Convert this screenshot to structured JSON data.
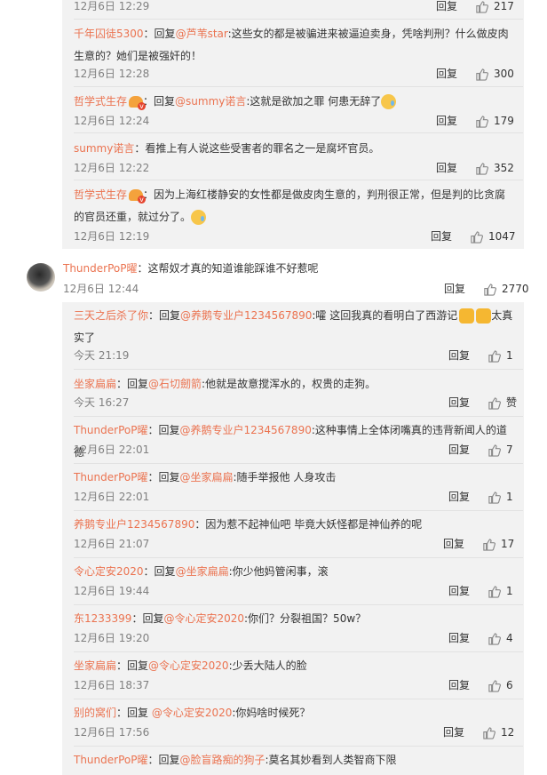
{
  "top_bar": {
    "time": "12月6日 12:29",
    "reply": "回复",
    "likes": "217"
  },
  "group1": [
    {
      "name": "千年囚徒5300",
      "prefix": "：回复",
      "at": "@芦苇star",
      "text": ":这些女的都是被骗进来被逼迫卖身，凭啥判刑？什么做皮肉生意的？她们是被强奸的！",
      "time": "12月6日 12:28",
      "reply": "回复",
      "likes": "300"
    },
    {
      "name": "哲学式生存",
      "prefix": "：回复",
      "at": "@summy诺言",
      "text": ":这就是欲加之罪 何患无辞了",
      "time": "12月6日 12:24",
      "reply": "回复",
      "likes": "179"
    },
    {
      "name": "summy诺言",
      "prefix": "：",
      "at": "",
      "text": "看推上有人说这些受害者的罪名之一是腐坏官员。",
      "time": "12月6日 12:22",
      "reply": "回复",
      "likes": "352"
    },
    {
      "name": "哲学式生存",
      "prefix": "：",
      "at": "",
      "text": "因为上海红楼静安的女性都是做皮肉生意的，判刑很正常，但是判的比贪腐的官员还重，就过分了。",
      "time": "12月6日 12:19",
      "reply": "回复",
      "likes": "1047"
    }
  ],
  "main_comment": {
    "name": "ThunderPoP曜",
    "text": "：这帮奴才真的知道谁能踩谁不好惹呢",
    "time": "12月6日 12:44",
    "reply": "回复",
    "likes": "2770"
  },
  "group2": [
    {
      "name": "三天之后杀了你",
      "prefix": "：回复",
      "at": "@养鹅专业户1234567890",
      "text": ":嚯 这回我真的看明白了西游记",
      "tail": "太真实了",
      "time": "今天 21:19",
      "reply": "回复",
      "likes": "1"
    },
    {
      "name": "坐家扁扁",
      "prefix": "：回复",
      "at": "@石切劒箭",
      "text": ":他就是故意搅浑水的，权贵的走狗。",
      "time": "今天 16:27",
      "reply": "回复",
      "likes": "赞"
    },
    {
      "name": "ThunderPoP曜",
      "prefix": "：回复",
      "at": "@养鹅专业户1234567890",
      "text": ":这种事情上全体闭嘴真的违背新闻人的道德",
      "time": "12月6日 22:01",
      "reply": "回复",
      "likes": "7"
    },
    {
      "name": "ThunderPoP曜",
      "prefix": "：回复",
      "at": "@坐家扁扁",
      "text": ":随手举报他 人身攻击",
      "time": "12月6日 22:01",
      "reply": "回复",
      "likes": "1"
    },
    {
      "name": "养鹅专业户1234567890",
      "prefix": "：",
      "at": "",
      "text": "因为惹不起神仙吧 毕竟大妖怪都是神仙养的呢",
      "time": "12月6日 21:07",
      "reply": "回复",
      "likes": "17"
    },
    {
      "name": "令心定安2020",
      "prefix": "：回复",
      "at": "@坐家扁扁",
      "text": ":你少他妈管闲事，滚",
      "time": "12月6日 19:44",
      "reply": "回复",
      "likes": "1"
    },
    {
      "name": "东1233399",
      "prefix": "：回复",
      "at": "@令心定安2020",
      "text": ":你们？分裂祖国？50w？",
      "time": "12月6日 19:20",
      "reply": "回复",
      "likes": "4"
    },
    {
      "name": "坐家扁扁",
      "prefix": "：回复",
      "at": "@令心定安2020",
      "text": ":少丢大陆人的脸",
      "time": "12月6日 18:37",
      "reply": "回复",
      "likes": "6"
    },
    {
      "name": "别的窝们",
      "prefix": "：回复 ",
      "at": "@令心定安2020",
      "text": ":你妈啥时候死？",
      "time": "12月6日 17:56",
      "reply": "回复",
      "likes": "12"
    },
    {
      "name": "ThunderPoP曜",
      "prefix": "：回复",
      "at": "@脸盲路痴的狗子",
      "text": ":莫名其妙看到人类智商下限",
      "time": "",
      "reply": "",
      "likes": ""
    }
  ],
  "colors": {
    "name": "#eb7350",
    "subbg": "#f2f2f2"
  }
}
